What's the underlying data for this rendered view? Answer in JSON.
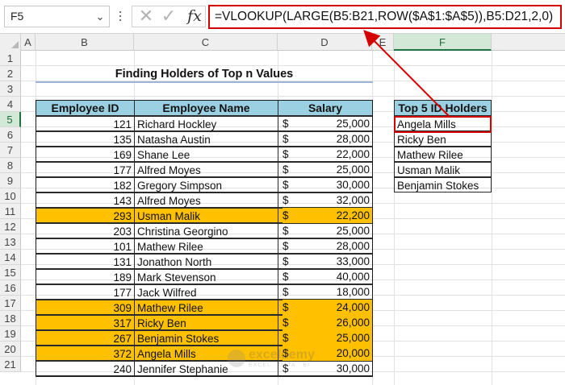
{
  "formula_bar": {
    "name_box": "F5",
    "cancel_icon": "✕",
    "enter_icon": "✓",
    "fx_label": "fx",
    "formula": "=VLOOKUP(LARGE(B5:B21,ROW($A$1:$A$5)),B5:D21,2,0)"
  },
  "columns": [
    "A",
    "B",
    "C",
    "D",
    "E",
    "F"
  ],
  "rows": [
    "1",
    "2",
    "3",
    "4",
    "5",
    "6",
    "7",
    "8",
    "9",
    "10",
    "11",
    "12",
    "13",
    "14",
    "15",
    "16",
    "17",
    "18",
    "19",
    "20",
    "21"
  ],
  "active_cell": "F5",
  "title": "Finding Holders of Top n Values",
  "table": {
    "headers": [
      "Employee ID",
      "Employee Name",
      "Salary"
    ],
    "currency_symbol": "$",
    "rows": [
      {
        "id": "121",
        "name": "Richard Hockley",
        "salary": "25,000",
        "highlight": false
      },
      {
        "id": "135",
        "name": "Natasha Austin",
        "salary": "28,000",
        "highlight": false
      },
      {
        "id": "169",
        "name": "Shane Lee",
        "salary": "22,000",
        "highlight": false
      },
      {
        "id": "177",
        "name": "Alfred Moyes",
        "salary": "25,000",
        "highlight": false
      },
      {
        "id": "182",
        "name": "Gregory Simpson",
        "salary": "30,000",
        "highlight": false
      },
      {
        "id": "143",
        "name": "Alfred Moyes",
        "salary": "32,000",
        "highlight": false
      },
      {
        "id": "293",
        "name": "Usman Malik",
        "salary": "22,200",
        "highlight": true
      },
      {
        "id": "203",
        "name": "Christina Georgino",
        "salary": "25,000",
        "highlight": false
      },
      {
        "id": "101",
        "name": "Mathew Rilee",
        "salary": "28,000",
        "highlight": false
      },
      {
        "id": "131",
        "name": "Jonathon North",
        "salary": "33,000",
        "highlight": false
      },
      {
        "id": "189",
        "name": "Mark Stevenson",
        "salary": "40,000",
        "highlight": false
      },
      {
        "id": "177",
        "name": "Jack Wilfred",
        "salary": "18,000",
        "highlight": false
      },
      {
        "id": "309",
        "name": "Mathew Rilee",
        "salary": "24,000",
        "highlight": true
      },
      {
        "id": "317",
        "name": "Ricky Ben",
        "salary": "26,000",
        "highlight": true
      },
      {
        "id": "267",
        "name": "Benjamin Stokes",
        "salary": "25,000",
        "highlight": true
      },
      {
        "id": "372",
        "name": "Angela Mills",
        "salary": "20,000",
        "highlight": true
      },
      {
        "id": "240",
        "name": "Jennifer Stephanie",
        "salary": "30,000",
        "highlight": false
      }
    ]
  },
  "top_table": {
    "header": "Top 5 ID Holders",
    "items": [
      "Angela Mills",
      "Ricky Ben",
      "Mathew Rilee",
      "Usman Malik",
      "Benjamin Stokes"
    ]
  },
  "watermark": {
    "name": "exceldemy",
    "tagline": "EXCEL · DATA · BI"
  },
  "colors": {
    "header_fill": "#9bd0e3",
    "highlight_fill": "#ffc000",
    "annotation_red": "#d40000",
    "selection_green": "#217346"
  }
}
